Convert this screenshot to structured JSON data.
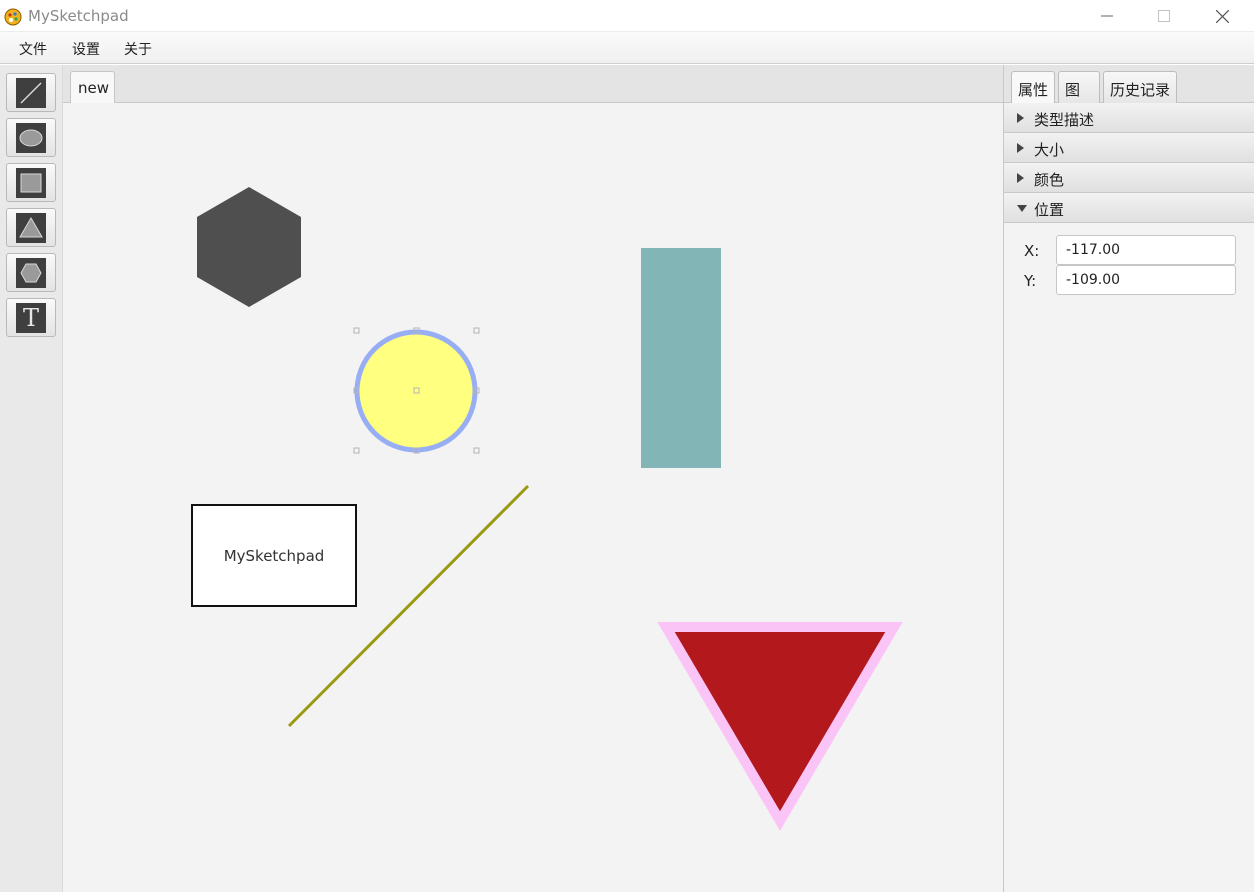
{
  "window": {
    "title": "MySketchpad",
    "controls": [
      "minimize",
      "maximize",
      "close"
    ]
  },
  "menu": {
    "items": [
      {
        "label": "文件"
      },
      {
        "label": "设置"
      },
      {
        "label": "关于"
      }
    ]
  },
  "toolbar": {
    "tools": [
      {
        "name": "line",
        "icon": "line-icon"
      },
      {
        "name": "ellipse",
        "icon": "ellipse-icon"
      },
      {
        "name": "rectangle",
        "icon": "rectangle-icon"
      },
      {
        "name": "triangle",
        "icon": "triangle-icon"
      },
      {
        "name": "hexagon",
        "icon": "hexagon-icon"
      },
      {
        "name": "text",
        "icon": "text-icon",
        "glyph": "T"
      }
    ]
  },
  "canvas": {
    "tabs": [
      {
        "label": "new",
        "active": true
      }
    ],
    "shapes": [
      {
        "type": "hexagon",
        "fill": "#4f4f4f"
      },
      {
        "type": "circle",
        "fill": "#ffff80",
        "stroke": "#97aef5",
        "selected": true
      },
      {
        "type": "rectangle",
        "fill": "#82b5b5"
      },
      {
        "type": "text",
        "text": "MySketchpad",
        "fill": "#ffffff",
        "stroke": "#111111"
      },
      {
        "type": "line",
        "stroke": "#9a9a12"
      },
      {
        "type": "triangle",
        "fill": "#b3181c",
        "stroke": "#fbc4f7"
      }
    ]
  },
  "panel": {
    "tabs": [
      {
        "label": "属性",
        "active": true
      },
      {
        "label": "图形"
      },
      {
        "label": "历史记录"
      }
    ],
    "sections": [
      {
        "label": "类型描述",
        "expanded": false
      },
      {
        "label": "大小",
        "expanded": false
      },
      {
        "label": "颜色",
        "expanded": false
      },
      {
        "label": "位置",
        "expanded": true
      }
    ],
    "position": {
      "x_label": "X:",
      "x_value": "-117.00",
      "y_label": "Y:",
      "y_value": "-109.00"
    }
  }
}
